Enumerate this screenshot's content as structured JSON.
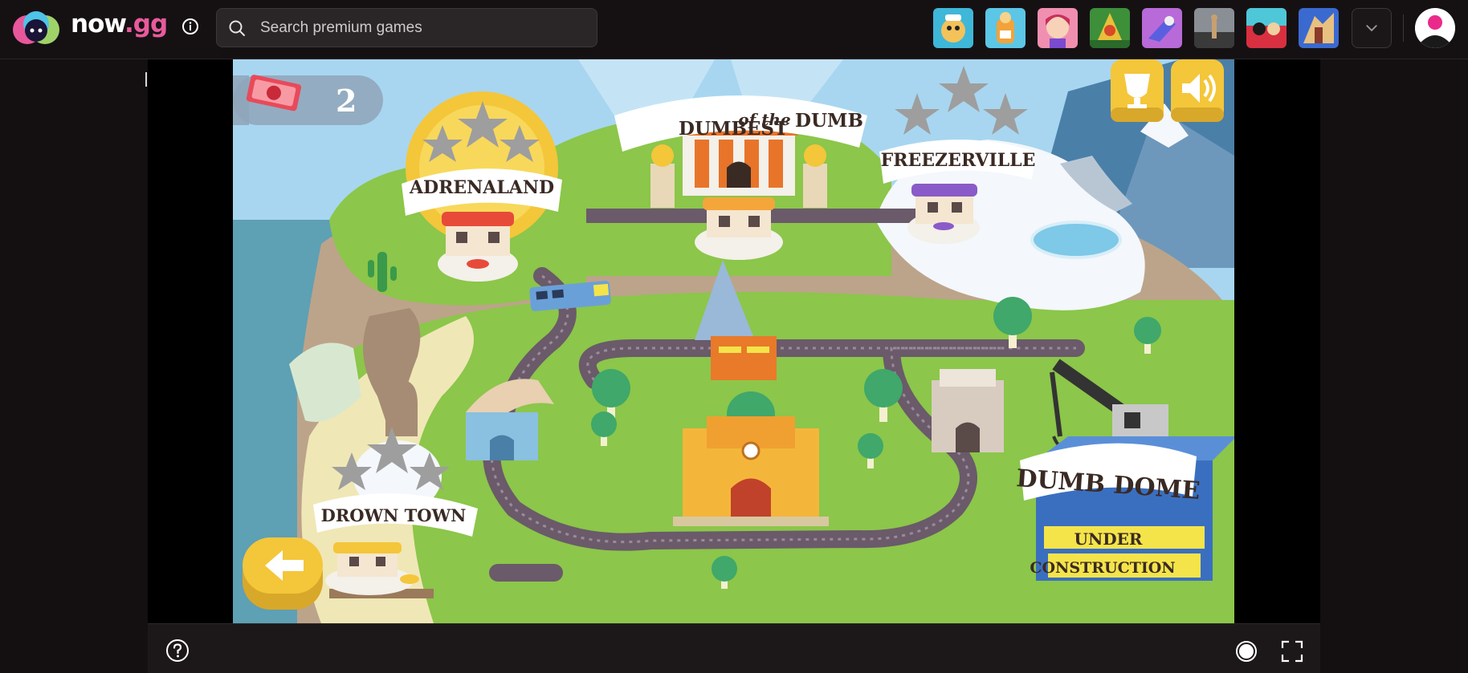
{
  "header": {
    "logo": {
      "now": "now",
      "gg": ".gg"
    },
    "search": {
      "placeholder": "Search premium games",
      "value": ""
    },
    "thumbnails": [
      {
        "name": "game-thumb-1",
        "bg": "#3fb7d8",
        "fg": "#f4c25a"
      },
      {
        "name": "game-thumb-2",
        "bg": "#5cc6e6",
        "fg": "#f2a33a"
      },
      {
        "name": "game-thumb-3",
        "bg": "#f18fb0",
        "fg": "#f6c04a"
      },
      {
        "name": "game-thumb-4",
        "bg": "#3d8f3a",
        "fg": "#e8c03a"
      },
      {
        "name": "game-thumb-5",
        "bg": "#b86ad8",
        "fg": "#5a5fe0"
      },
      {
        "name": "game-thumb-6",
        "bg": "#6a6a6a",
        "fg": "#c8a070"
      },
      {
        "name": "game-thumb-7",
        "bg": "#d83040",
        "fg": "#4ec8d8"
      },
      {
        "name": "game-thumb-8",
        "bg": "#3a6ad0",
        "fg": "#e8c080"
      }
    ],
    "accent": "#e85a9c"
  },
  "game": {
    "ticket_count": "2",
    "zones": {
      "adrenaland": "ADRENALAND",
      "dumbest_a": "DUMBEST",
      "dumbest_b": "of the",
      "dumbest_c": "DUMB",
      "freezerville": "FREEZERVILLE",
      "drown_town": "DROWN TOWN",
      "dumb_dome": "DUMB DOME",
      "under": "UNDER",
      "construction": "CONSTRUCTION"
    }
  }
}
